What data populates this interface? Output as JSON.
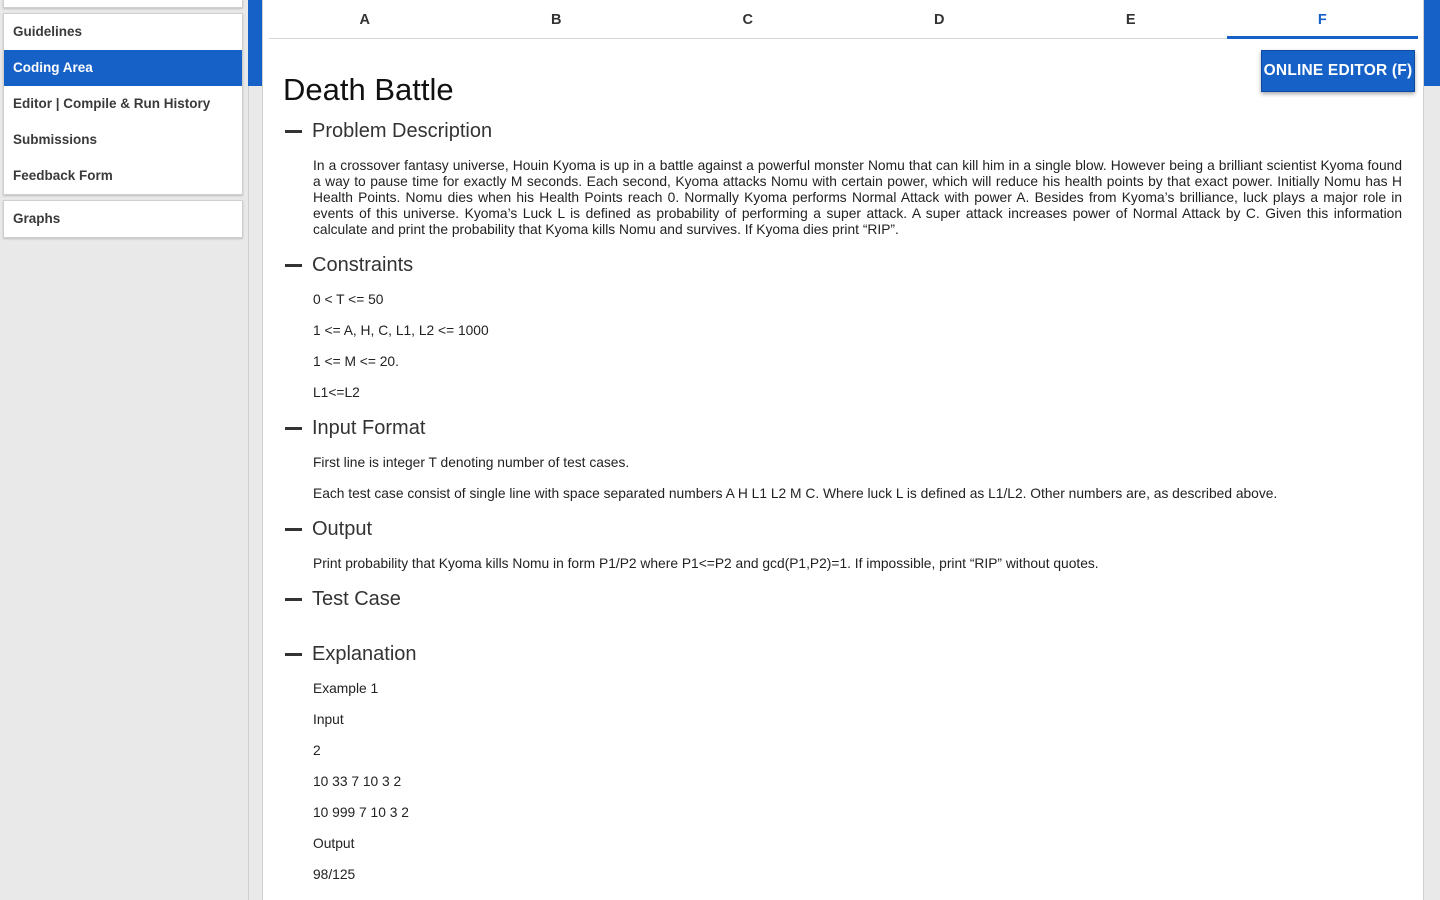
{
  "sidebar": {
    "items": [
      {
        "label": "Guidelines"
      },
      {
        "label": "Coding Area"
      },
      {
        "label": "Editor | Compile & Run History"
      },
      {
        "label": "Submissions"
      },
      {
        "label": "Feedback Form"
      }
    ],
    "active": "Coding Area",
    "graphs_label": "Graphs"
  },
  "tabs": [
    {
      "label": "A"
    },
    {
      "label": "B"
    },
    {
      "label": "C"
    },
    {
      "label": "D"
    },
    {
      "label": "E"
    },
    {
      "label": "F"
    }
  ],
  "active_tab": "F",
  "editor_button": "ONLINE EDITOR (F)",
  "problem": {
    "title": "Death Battle",
    "sections": {
      "description": {
        "title": "Problem Description",
        "text": "In a crossover fantasy universe, Houin Kyoma is up in a battle against a powerful monster Nomu that can kill him in a single blow. However being a brilliant scientist Kyoma found a way to pause time for exactly M seconds. Each second, Kyoma attacks Nomu with certain power, which will reduce his health points by that exact power. Initially Nomu has H Health Points. Nomu dies when his Health Points reach 0. Normally Kyoma performs Normal Attack with power A. Besides from Kyoma’s brilliance, luck plays a major role in events of this universe. Kyoma’s Luck L is defined as probability of performing a super attack. A super attack increases power of Normal Attack by C. Given this information calculate and print the probability that Kyoma kills Nomu and survives. If Kyoma dies print “RIP”."
      },
      "constraints": {
        "title": "Constraints",
        "lines": [
          "0 < T <= 50",
          "1 <= A, H, C, L1, L2 <= 1000",
          "1 <= M <= 20.",
          "L1<=L2"
        ]
      },
      "input": {
        "title": "Input Format",
        "lines": [
          "First line is integer T denoting number of test cases.",
          "Each test case consist of single line with space separated numbers A H L1 L2 M C. Where luck L is defined as L1/L2. Other numbers are, as described above."
        ]
      },
      "output": {
        "title": "Output",
        "lines": [
          "Print probability that Kyoma kills Nomu in form P1/P2 where P1<=P2 and gcd(P1,P2)=1. If impossible, print “RIP” without quotes."
        ]
      },
      "testcase": {
        "title": "Test Case"
      },
      "explanation": {
        "title": "Explanation",
        "lines": [
          "Example 1",
          "Input",
          "2",
          "10 33 7 10 3 2",
          "10 999 7 10 3 2",
          "Output",
          "98/125"
        ]
      }
    }
  },
  "colors": {
    "accent": "#1561c7",
    "background": "#e9e9e9",
    "panel": "#ffffff"
  },
  "icons": {
    "collapse": "minus-icon"
  }
}
